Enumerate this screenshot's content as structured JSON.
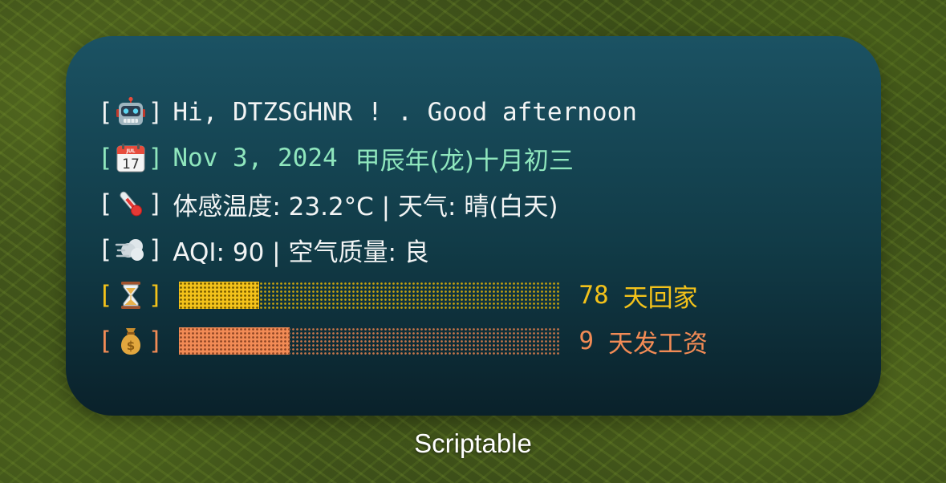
{
  "widget": {
    "greeting": "Hi, DTZSGHNR ! . Good afternoon",
    "date": "Nov 3, 2024",
    "lunar_date": "甲辰年(龙)十月初三",
    "weather": "体感温度: 23.2°C | 天气: 晴(白天)",
    "aqi": "AQI: 90 | 空气质量: 良",
    "home_countdown": {
      "days": "78",
      "label": "天回家",
      "progress": 0.21,
      "color": "#f3c21a"
    },
    "payday_countdown": {
      "days": "9",
      "label": "天发工资",
      "progress": 0.29,
      "color": "#f28b55"
    },
    "icons": [
      "robot-icon",
      "calendar-icon",
      "thermometer-icon",
      "wind-icon",
      "hourglass-icon",
      "money-bag-icon"
    ],
    "calendar_icon_text": {
      "month": "JUL",
      "day": "17"
    }
  },
  "app_label": "Scriptable",
  "colors": {
    "text_white": "#f2f4f4",
    "date_green": "#8fe6bd",
    "home_yellow": "#f3c21a",
    "pay_orange": "#f28b55"
  }
}
